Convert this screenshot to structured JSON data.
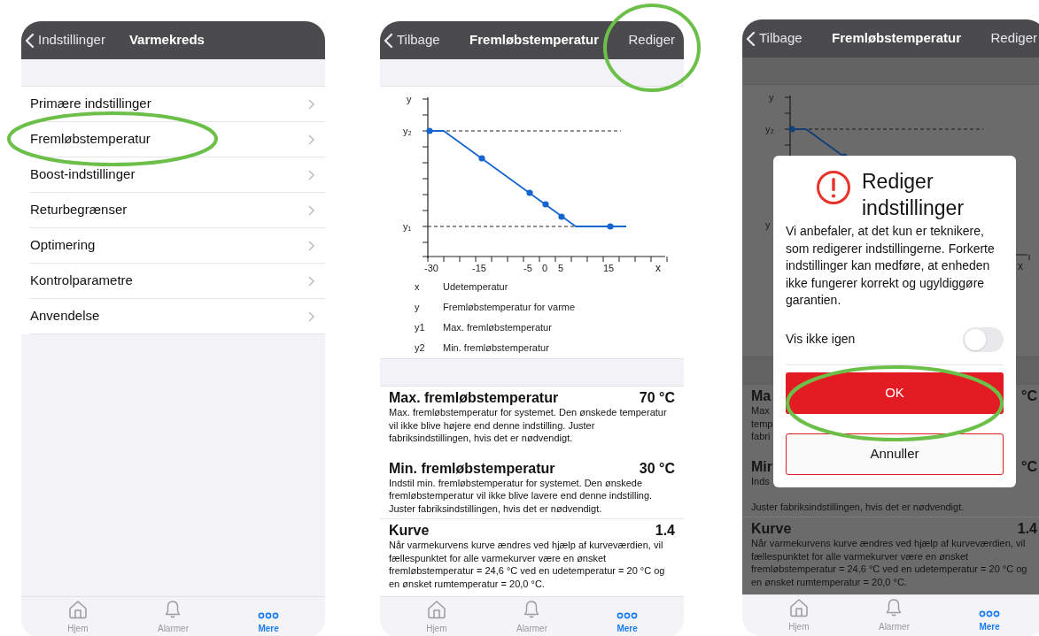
{
  "screens": [
    {
      "kind": "menu",
      "header": {
        "back": "Indstillinger",
        "title": "Varmekreds"
      },
      "items": [
        {
          "label": "Primære indstillinger"
        },
        {
          "label": "Fremløbstemperatur"
        },
        {
          "label": "Boost-indstillinger"
        },
        {
          "label": "Returbegrænser"
        },
        {
          "label": "Optimering"
        },
        {
          "label": "Kontrolparametre"
        },
        {
          "label": "Anvendelse"
        }
      ],
      "tabs": [
        {
          "label": "Hjem",
          "kind": "home",
          "selected": false
        },
        {
          "label": "Alarmer",
          "kind": "bell",
          "selected": false
        },
        {
          "label": "Mere",
          "kind": "more",
          "selected": true
        }
      ]
    },
    {
      "kind": "detail",
      "header": {
        "back": "Tilbage",
        "title": "Fremløbstemperatur",
        "action": "Rediger"
      },
      "chart": {
        "y_label": "y",
        "top_mark": "y₂",
        "bottom_mark": "y₁",
        "x_label": "x",
        "x_ticks": [
          "-30",
          "-15",
          "-5",
          "0",
          "5",
          "15"
        ]
      },
      "legend": [
        {
          "key": "x",
          "text": "Udetemperatur"
        },
        {
          "key": "y",
          "text": "Fremløbstemperatur for varme"
        },
        {
          "key": "y1",
          "text": "Max. fremløbstemperatur"
        },
        {
          "key": "y2",
          "text": "Min. fremløbstemperatur"
        }
      ],
      "sections": [
        {
          "title": "Max. fremløbstemperatur",
          "value": "70 °C",
          "text": "Max. fremløbstemperatur for systemet. Den ønskede temperatur vil ikke blive højere end denne indstilling. Juster fabriksindstillingen, hvis det er nødvendigt."
        },
        {
          "title": "Min. fremløbstemperatur",
          "value": "30 °C",
          "text": "Indstil min. fremløbstemperatur for systemet. Den ønskede fremløbstemperatur vil ikke blive lavere end denne indstilling. Juster fabriksindstillingen, hvis det er nødvendigt."
        },
        {
          "title": "Kurve",
          "value": "1.4",
          "text": "Når varmekurvens kurve ændres ved hjælp af kurveværdien, vil fællespunktet for alle varmekurver være en ønsket fremløbstemperatur = 24,6 °C ved en udetemperatur = 20 °C og en ønsket rumtemperatur = 20,0 °C."
        }
      ],
      "tabs": [
        {
          "label": "Hjem",
          "kind": "home",
          "selected": false
        },
        {
          "label": "Alarmer",
          "kind": "bell",
          "selected": false
        },
        {
          "label": "Mere",
          "kind": "more",
          "selected": true
        }
      ]
    },
    {
      "kind": "detail",
      "header": {
        "back": "Tilbage",
        "title": "Fremløbstemperatur",
        "action": "Rediger"
      },
      "chart": {
        "y_label": "y",
        "top_mark": "y₂",
        "bottom_mark": "y",
        "x_label": "x"
      },
      "sections": [
        {
          "title": "Ma",
          "value": "°C",
          "lines": [
            "Max",
            "temp",
            "fabri"
          ]
        },
        {
          "title": "Mir",
          "value": "°C",
          "lines": [
            "Inds"
          ],
          "tail": "Juster fabriksindstillingen, hvis det er nødvendigt."
        },
        {
          "title": "Kurve",
          "value": "1.4",
          "text": "Når varmekurvens kurve ændres ved hjælp af kurveværdien, vil fællespunktet for alle varmekurver være en ønsket fremløbstemperatur = 24,6 °C ved en udetemperatur = 20 °C og en ønsket rumtemperatur = 20,0 °C."
        }
      ],
      "dialog": {
        "title": "Rediger indstillinger",
        "message": "Vi anbefaler, at det kun er teknikere, som redigerer indstillingerne. Forkerte indstillinger kan medføre, at enheden ikke fungerer korrekt og ugyldiggøre garantien.",
        "toggle": {
          "label": "Vis ikke igen",
          "on": false
        },
        "buttons": [
          {
            "label": "OK",
            "kind": "primary"
          },
          {
            "label": "Annuller",
            "kind": "secondary"
          }
        ]
      },
      "tabs": [
        {
          "label": "Hjem",
          "kind": "home",
          "selected": false
        },
        {
          "label": "Alarmer",
          "kind": "bell",
          "selected": false
        },
        {
          "label": "Mere",
          "kind": "more",
          "selected": true
        }
      ]
    }
  ]
}
